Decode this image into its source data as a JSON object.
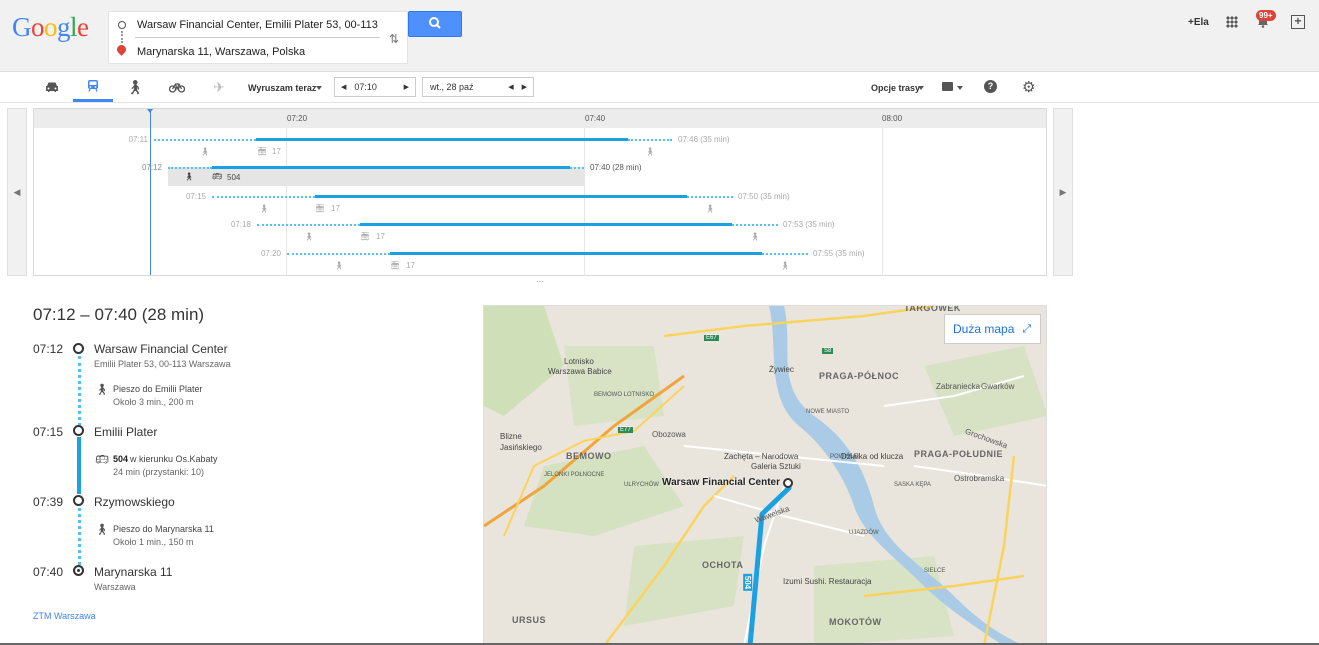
{
  "header": {
    "logo": "Google",
    "origin": "Warsaw Financial Center, Emilii Plater 53, 00-113",
    "destination": "Marynarska 11, Warszawa, Polska",
    "user": "+Ela",
    "notifications_badge": "99+"
  },
  "toolbar": {
    "depart_mode": "Wyruszam teraz",
    "time": "07:10",
    "date": "wt., 28 paź",
    "route_options": "Opcje trasy"
  },
  "timeline": {
    "ticks": [
      "07:20",
      "07:40",
      "08:00"
    ],
    "rows": [
      {
        "dep": "07:11",
        "arr": "07:46 (35 min)",
        "line": "17"
      },
      {
        "dep": "07:12",
        "arr": "07:40 (28 min)",
        "line": "504"
      },
      {
        "dep": "07:15",
        "arr": "07:50 (35 min)",
        "line": "17"
      },
      {
        "dep": "07:18",
        "arr": "07:53 (35 min)",
        "line": "17"
      },
      {
        "dep": "07:20",
        "arr": "07:55 (35 min)",
        "line": "17"
      }
    ],
    "more": "..."
  },
  "details": {
    "summary": "07:12 – 07:40 (28 min)",
    "stops": [
      {
        "time": "07:12",
        "name": "Warsaw Financial Center",
        "sub": "Emilii Plater 53, 00-113 Warszawa"
      },
      {
        "time": "07:15",
        "name": "Emilii Plater",
        "sub": ""
      },
      {
        "time": "07:39",
        "name": "Rzymowskiego",
        "sub": ""
      },
      {
        "time": "07:40",
        "name": "Marynarska 11",
        "sub": "Warszawa"
      }
    ],
    "walk1": {
      "title": "Pieszo do Emilii Plater",
      "sub": "Około 3 min., 200 m"
    },
    "bus": {
      "line": "504",
      "dir": "w kierunku Os.Kabaty",
      "sub": "24 min (przystanki: 10)"
    },
    "walk2": {
      "title": "Pieszo do Marynarska 11",
      "sub": "Około 1 min., 150 m"
    },
    "agency": "ZTM Warszawa"
  },
  "map": {
    "big_map": "Duża mapa",
    "start_label": "Warsaw Financial Center",
    "labels": {
      "targowek": "TARGÓWEK",
      "praga_n": "PRAGA-PÓŁNOC",
      "praga_s": "PRAGA-POŁUDNIE",
      "bemowo": "BEMOWO",
      "ochota": "OCHOTA",
      "mokotow": "MOKOTÓW",
      "ursus": "URSUS",
      "lotnisko": "Lotnisko",
      "lotnisko2": "Warszawa Babice",
      "blizne": "Blizne",
      "blizne2": "Jasińskiego",
      "zywiec": "Żywiec",
      "zacheta": "Zachęta – Narodowa",
      "zacheta2": "Galeria Sztuki",
      "dzialka": "Działka od klucza",
      "izumi": "Izumi Sushi. Restauracja",
      "nowe_miasto": "NOWE MIASTO",
      "powisle": "POWIŚLE",
      "saska": "SASKA KĘPA",
      "ujazdow": "UJAZDÓW",
      "sielce": "SIELCE",
      "jelonki": "JELONKI POŁNOCNE",
      "ulrychow": "ULRYCHÓW",
      "bemowo_lotnisko": "BEMOWO LOTNISKO",
      "e67": "E67",
      "e77": "E77",
      "s8": "S8",
      "obozowa": "Obozowa",
      "wawelska": "Wawelska",
      "grochowska": "Grochowska",
      "ostrobramska": "Ostrobramska",
      "bus504": "504",
      "gwarkow": "Gwarków",
      "zabraniecka": "Zabraniecka"
    }
  }
}
